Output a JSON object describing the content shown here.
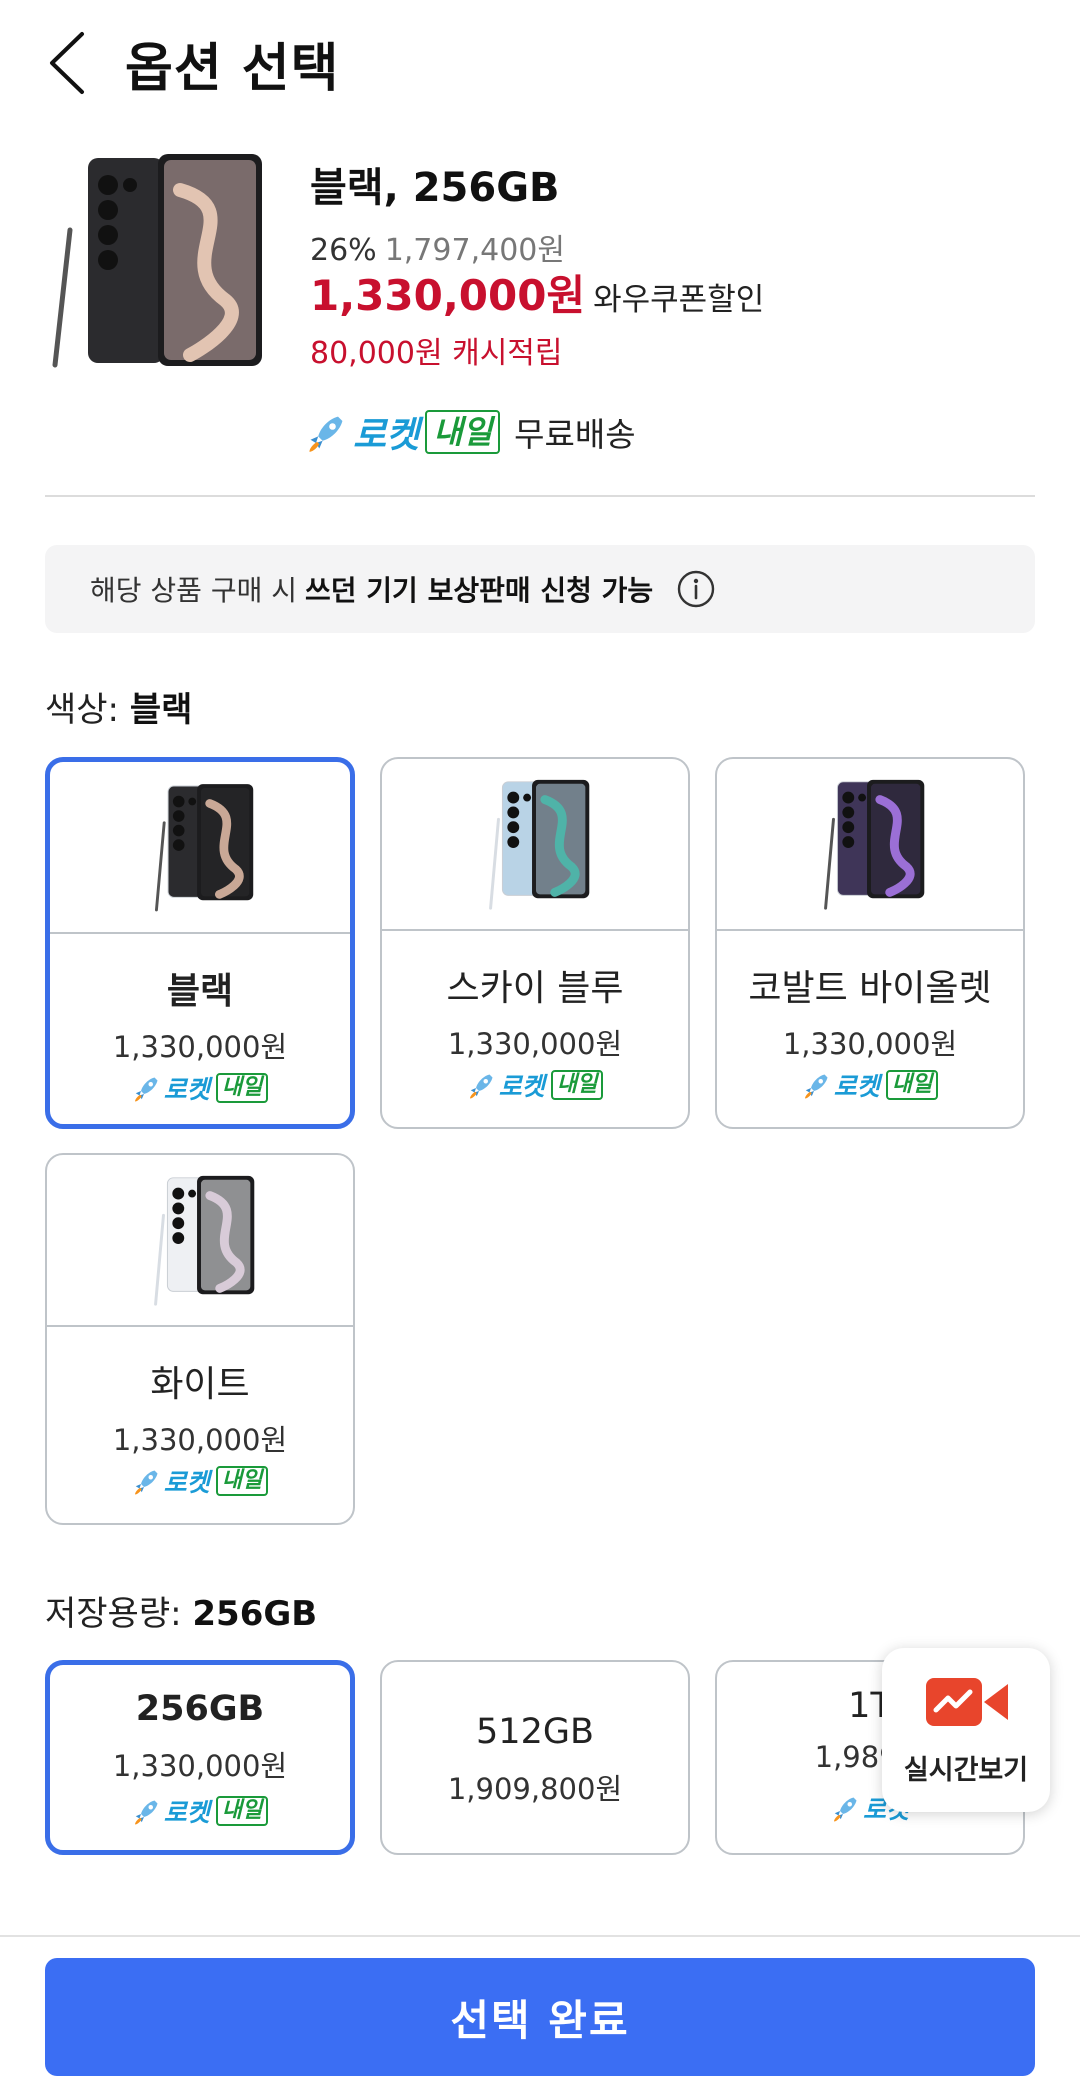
{
  "header": {
    "title": "옵션 선택"
  },
  "product": {
    "option_name": "블랙, 256GB",
    "discount_rate": "26%",
    "original_price": "1,797,400원",
    "price": "1,330,000원",
    "coupon_label": "와우쿠폰할인",
    "cashback": "80,000원 캐시적립",
    "shipping": {
      "rocket_label": "로켓",
      "naeil_label": "내일",
      "free_label": "무료배송"
    }
  },
  "notice": {
    "prefix": "해당 상품 구매 시",
    "highlight": "쓰던 기기 보상판매 신청 가능",
    "icon": "info-icon"
  },
  "color_section": {
    "label": "색상:",
    "selected": "블랙",
    "options": [
      {
        "name": "블랙",
        "price": "1,330,000원",
        "rocket": "로켓",
        "naeil": "내일",
        "body_color": "#2b2b2e",
        "screen_accent": "#c9a896",
        "selected": true
      },
      {
        "name": "스카이 블루",
        "price": "1,330,000원",
        "rocket": "로켓",
        "naeil": "내일",
        "body_color": "#b9d3e6",
        "screen_accent": "#4fb3a8",
        "selected": false
      },
      {
        "name": "코발트 바이올렛",
        "price": "1,330,000원",
        "rocket": "로켓",
        "naeil": "내일",
        "body_color": "#3f3558",
        "screen_accent": "#9b6fd6",
        "selected": false
      },
      {
        "name": "화이트",
        "price": "1,330,000원",
        "rocket": "로켓",
        "naeil": "내일",
        "body_color": "#eef0f3",
        "screen_accent": "#d8cbd8",
        "selected": false
      }
    ]
  },
  "storage_section": {
    "label": "저장용량:",
    "selected": "256GB",
    "options": [
      {
        "name": "256GB",
        "price": "1,330,000원",
        "rocket": "로켓",
        "naeil": "내일",
        "selected": true
      },
      {
        "name": "512GB",
        "price": "1,909,800원",
        "selected": false
      },
      {
        "name": "1T",
        "price": "1,989,9",
        "rocket": "로켓",
        "selected": false
      }
    ]
  },
  "live_button": {
    "label": "실시간보기",
    "icon": "live-video-icon"
  },
  "footer": {
    "confirm_label": "선택 완료"
  },
  "colors": {
    "accent_blue": "#3b6ef3",
    "price_red": "#c8102e",
    "rocket_blue": "#1a9bd6",
    "naeil_green": "#1a9a3a",
    "live_red": "#e8452c"
  }
}
